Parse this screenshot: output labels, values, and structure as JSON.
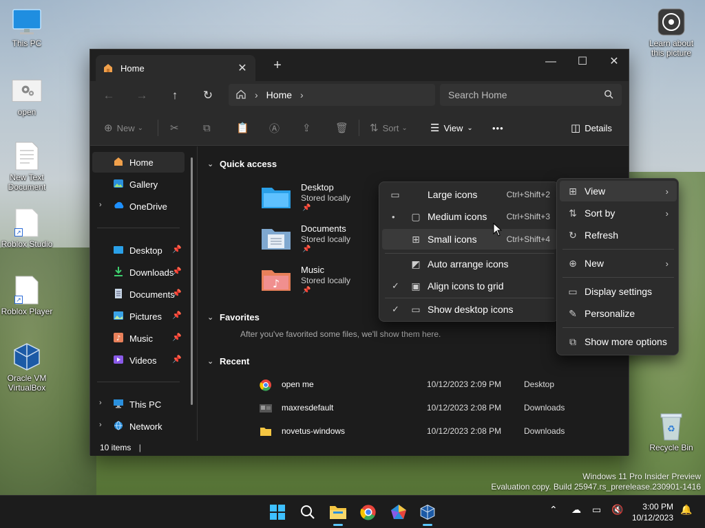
{
  "desktop": {
    "icons": [
      {
        "label": "This PC"
      },
      {
        "label": "open"
      },
      {
        "label": "New Text Document"
      },
      {
        "label": "Roblox Studio"
      },
      {
        "label": "Roblox Player"
      },
      {
        "label": "Oracle VM VirtualBox"
      },
      {
        "label": "Learn about this picture"
      },
      {
        "label": "Recycle Bin"
      }
    ]
  },
  "explorer": {
    "tab_title": "Home",
    "tab_close": "✕",
    "new_tab": "+",
    "window_controls": {
      "minimize": "—",
      "maximize": "☐",
      "close": "✕"
    },
    "address": {
      "path": "Home"
    },
    "search": {
      "placeholder": "Search Home"
    },
    "commands": {
      "new": "New",
      "sort": "Sort",
      "view": "View",
      "more": "•••",
      "details": "Details"
    },
    "sidebar": {
      "items": [
        {
          "label": "Home"
        },
        {
          "label": "Gallery"
        },
        {
          "label": "OneDrive"
        },
        {
          "label": "Desktop"
        },
        {
          "label": "Downloads"
        },
        {
          "label": "Documents"
        },
        {
          "label": "Pictures"
        },
        {
          "label": "Music"
        },
        {
          "label": "Videos"
        },
        {
          "label": "This PC"
        },
        {
          "label": "Network"
        }
      ]
    },
    "sections": {
      "quick_access": "Quick access",
      "favorites": "Favorites",
      "favorites_empty": "After you've favorited some files, we'll show them here.",
      "recent": "Recent"
    },
    "quick_access": [
      {
        "name": "Desktop",
        "status": "Stored locally"
      },
      {
        "name": "Documents",
        "status": "Stored locally"
      },
      {
        "name": "Music",
        "status": "Stored locally"
      }
    ],
    "recent": [
      {
        "name": "open me",
        "date": "10/12/2023 2:09 PM",
        "location": "Desktop"
      },
      {
        "name": "maxresdefault",
        "date": "10/12/2023 2:08 PM",
        "location": "Downloads"
      },
      {
        "name": "novetus-windows",
        "date": "10/12/2023 2:08 PM",
        "location": "Downloads"
      }
    ],
    "status": "10 items"
  },
  "view_menu": {
    "items": [
      {
        "label": "Large icons",
        "shortcut": "Ctrl+Shift+2",
        "mark": ""
      },
      {
        "label": "Medium icons",
        "shortcut": "Ctrl+Shift+3",
        "mark": "•"
      },
      {
        "label": "Small icons",
        "shortcut": "Ctrl+Shift+4",
        "mark": ""
      },
      {
        "label": "Auto arrange icons",
        "shortcut": "",
        "mark": ""
      },
      {
        "label": "Align icons to grid",
        "shortcut": "",
        "mark": "✓"
      },
      {
        "label": "Show desktop icons",
        "shortcut": "",
        "mark": "✓"
      }
    ]
  },
  "context_menu": {
    "items": [
      {
        "label": "View"
      },
      {
        "label": "Sort by"
      },
      {
        "label": "Refresh"
      },
      {
        "label": "New"
      },
      {
        "label": "Display settings"
      },
      {
        "label": "Personalize"
      },
      {
        "label": "Show more options"
      }
    ]
  },
  "watermark": {
    "line1": "Windows 11 Pro Insider Preview",
    "line2": "Evaluation copy. Build 25947.rs_prerelease.230901-1416"
  },
  "taskbar": {
    "time": "3:00 PM",
    "date": "10/12/2023"
  },
  "colors": {
    "accent": "#5cc7ff",
    "folder_desktop": "#2aa0e8",
    "folder_documents": "#7fa8d0",
    "folder_music": "#e8805a"
  }
}
